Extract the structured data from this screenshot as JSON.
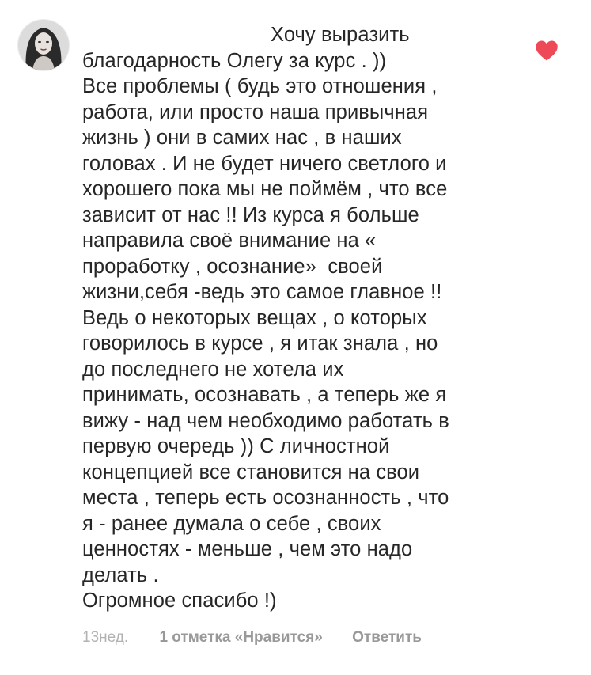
{
  "comment": {
    "lines": [
      "Хочу выразить",
      "благодарность Олегу за курс . ))",
      "Все проблемы ( будь это отношения ,",
      "работа, или просто наша привычная",
      "жизнь ) они в самих нас , в наших",
      "головах . И не будет ничего светлого и",
      "хорошего пока мы не поймём , что все",
      "зависит от нас !! Из курса я больше",
      "направила своё внимание на «",
      "проработку , осознание»  своей",
      "жизни,себя -ведь это самое главное !!",
      "Ведь о некоторых вещах , о которых",
      "говорилось в курсе , я итак знала , но",
      "до последнего не хотела их",
      "принимать, осознавать , а теперь же я",
      "вижу - над чем необходимо работать в",
      "первую очередь )) С личностной",
      "концепцией все становится на свои",
      "места , теперь есть осознанность , что",
      "я - ранее думала о себе , своих",
      "ценностях - меньше , чем это надо",
      "делать .",
      "Огромное спасибо !)"
    ],
    "time": "13нед.",
    "likes_label": "1 отметка «Нравится»",
    "reply_label": "Ответить"
  },
  "icons": {
    "avatar": "profile-photo",
    "like": "heart-icon"
  },
  "colors": {
    "text": "#262626",
    "meta": "#999999",
    "heart": "#ed4956"
  }
}
